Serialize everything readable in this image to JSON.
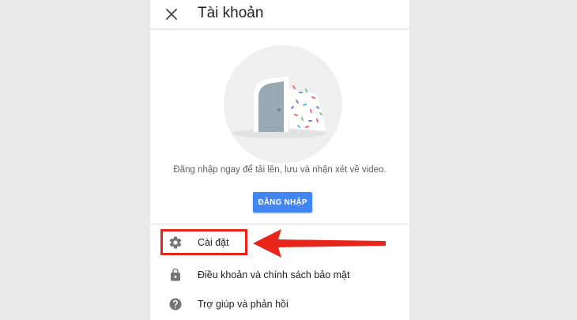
{
  "header": {
    "title": "Tài khoản",
    "close_icon": "close-icon"
  },
  "signin": {
    "message": "Đăng nhập ngay để tải lên, lưu và nhận xét về video.",
    "button_label": "ĐĂNG NHẬP",
    "button_color": "#4285f4"
  },
  "menu": {
    "items": [
      {
        "label": "Cài đặt",
        "icon": "gear-icon"
      },
      {
        "label": "Điều khoản và chính sách bảo mật",
        "icon": "lock-icon"
      },
      {
        "label": "Trợ giúp và phản hồi",
        "icon": "help-icon"
      }
    ]
  },
  "annotation": {
    "highlight_color": "#e8251a"
  }
}
